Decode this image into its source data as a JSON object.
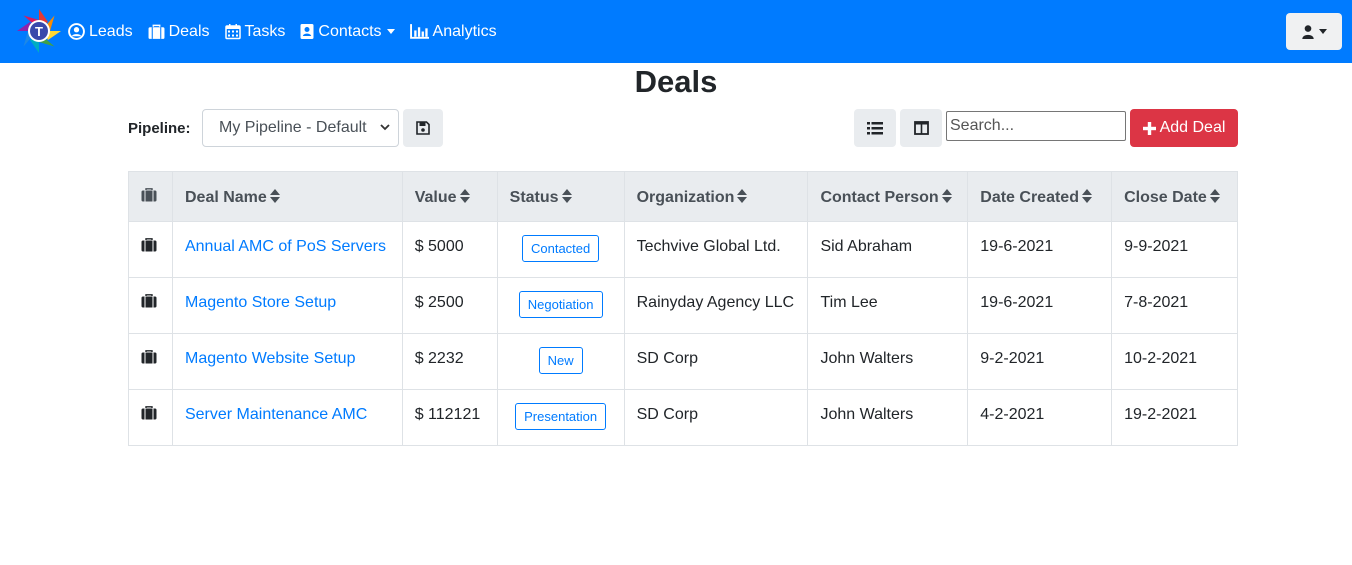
{
  "navbar": {
    "logo_letter": "T",
    "links": [
      {
        "label": "Leads",
        "icon": "user-circle-icon"
      },
      {
        "label": "Deals",
        "icon": "briefcase-icon"
      },
      {
        "label": "Tasks",
        "icon": "calendar-icon"
      },
      {
        "label": "Contacts",
        "icon": "address-book-icon",
        "dropdown": true
      },
      {
        "label": "Analytics",
        "icon": "bar-chart-icon"
      }
    ],
    "user_menu_icon": "user-icon"
  },
  "page": {
    "title": "Deals"
  },
  "toolbar": {
    "pipeline_label": "Pipeline:",
    "pipeline_selected": "My Pipeline - Default",
    "save_icon": "floppy-disk-icon",
    "list_view_icon": "list-icon",
    "board_view_icon": "columns-icon",
    "search_placeholder": "Search...",
    "search_value": "",
    "add_label": "Add Deal"
  },
  "table": {
    "columns": [
      "Deal Name",
      "Value",
      "Status",
      "Organization",
      "Contact Person",
      "Date Created",
      "Close Date"
    ],
    "rows": [
      {
        "name": "Annual AMC of PoS Servers",
        "value": "$ 5000",
        "status": "Contacted",
        "organization": "Techvive Global Ltd.",
        "contact": "Sid Abraham",
        "created": "19-6-2021",
        "close": "9-9-2021"
      },
      {
        "name": "Magento Store Setup",
        "value": "$ 2500",
        "status": "Negotiation",
        "organization": "Rainyday Agency LLC",
        "contact": "Tim Lee",
        "created": "19-6-2021",
        "close": "7-8-2021"
      },
      {
        "name": "Magento Website Setup",
        "value": "$ 2232",
        "status": "New",
        "organization": "SD Corp",
        "contact": "John Walters",
        "created": "9-2-2021",
        "close": "10-2-2021"
      },
      {
        "name": "Server Maintenance AMC",
        "value": "$ 112121",
        "status": "Presentation",
        "organization": "SD Corp",
        "contact": "John Walters",
        "created": "4-2-2021",
        "close": "19-2-2021"
      }
    ]
  },
  "colors": {
    "primary": "#007bff",
    "danger": "#dc3545",
    "header_bg": "#e9ecef"
  }
}
